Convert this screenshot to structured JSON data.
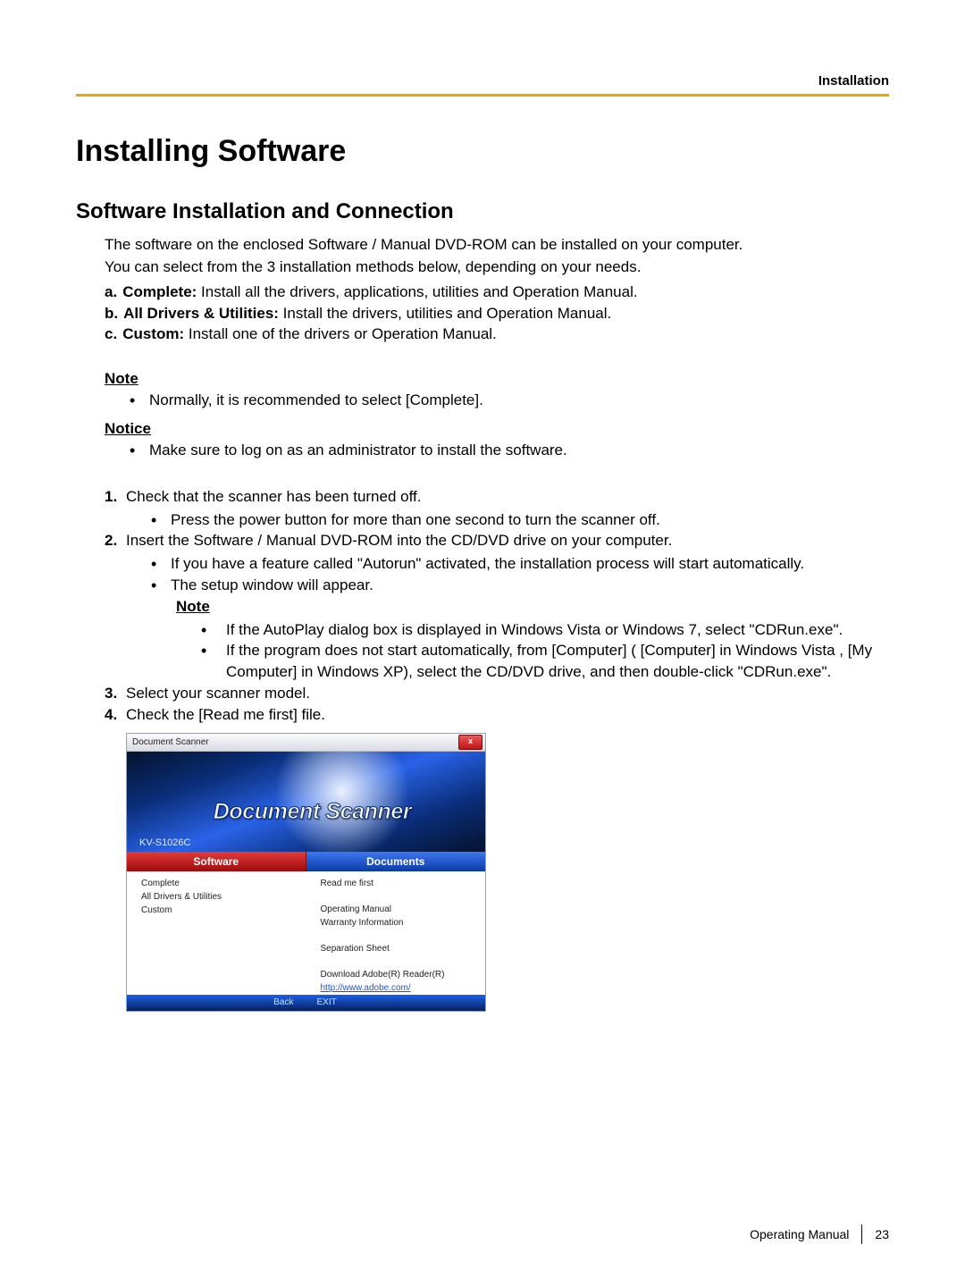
{
  "header": {
    "section": "Installation"
  },
  "h1": "Installing Software",
  "h2": "Software Installation and Connection",
  "intro": {
    "p1": "The software on the enclosed Software / Manual DVD-ROM can be installed on your computer.",
    "p2": "You can select from the 3 installation methods below, depending on your needs."
  },
  "options": {
    "a": {
      "letter": "a.",
      "title": "Complete:",
      "desc": " Install all the drivers, applications, utilities and Operation Manual."
    },
    "b": {
      "letter": "b.",
      "title": "All Drivers & Utilities:",
      "desc": " Install the drivers, utilities and Operation Manual."
    },
    "c": {
      "letter": "c.",
      "title": "Custom:",
      "desc": " Install one of the drivers or Operation Manual."
    }
  },
  "note1": {
    "label": "Note",
    "item": "Normally, it is recommended to select [Complete]."
  },
  "notice": {
    "label": "Notice",
    "item": "Make sure to log on as an administrator to install the software."
  },
  "steps": {
    "s1": {
      "num": "1.",
      "text": "Check that the scanner has been turned off.",
      "sub1": "Press the power button for more than one second to turn the scanner off."
    },
    "s2": {
      "num": "2.",
      "text": "Insert the Software / Manual DVD-ROM into the CD/DVD drive on your computer.",
      "sub1": "If you have a feature called \"Autorun\" activated, the installation process will start automatically.",
      "sub2": "The setup window will appear."
    },
    "s2note": {
      "label": "Note",
      "i1": "If the AutoPlay dialog box is displayed in Windows Vista or Windows 7, select \"CDRun.exe\".",
      "i2": "If the program does not start automatically, from [Computer] ( [Computer] in Windows Vista , [My Computer] in Windows XP), select the CD/DVD drive, and then double-click \"CDRun.exe\"."
    },
    "s3": {
      "num": "3.",
      "text": "Select your scanner model."
    },
    "s4": {
      "num": "4.",
      "text": "Check the [Read me first] file."
    }
  },
  "screenshot": {
    "title": "Document Scanner",
    "close": "x",
    "logo": "Document Scanner",
    "model": "KV-S1026C",
    "softwareHeader": "Software",
    "documentsHeader": "Documents",
    "software": {
      "i1": "Complete",
      "i2": "All Drivers & Utilities",
      "i3": "Custom"
    },
    "documents": {
      "i1": "Read me first",
      "i2": "Operating Manual",
      "i3": "Warranty Information",
      "i4": "Separation Sheet",
      "i5": "Download Adobe(R) Reader(R)",
      "link": "http://www.adobe.com/"
    },
    "footer": {
      "back": "Back",
      "exit": "EXIT"
    }
  },
  "footer": {
    "manual": "Operating Manual",
    "page": "23"
  }
}
